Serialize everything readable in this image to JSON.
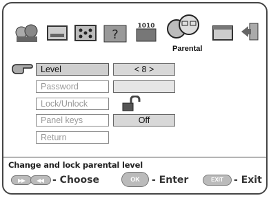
{
  "active_section": "Parental",
  "menu": {
    "items": [
      {
        "label": "Level",
        "selected": true
      },
      {
        "label": "Password",
        "selected": false
      },
      {
        "label": "Lock/Unlock",
        "selected": false
      },
      {
        "label": "Panel keys",
        "selected": false
      },
      {
        "label": "Return",
        "selected": false
      }
    ]
  },
  "values": {
    "level": "< 8 >",
    "panel_keys": "Off"
  },
  "help": {
    "text": "Change and lock parental level",
    "choose": "- Choose",
    "enter": "- Enter",
    "exit": "- Exit",
    "ok_key": "OK",
    "exit_key": "EXIT"
  },
  "icons": [
    "people-icon",
    "tv-screen-icon",
    "dice-icon",
    "question-icon",
    "digital-icon",
    "parental-faces-icon",
    "window-icon",
    "exit-door-icon"
  ]
}
